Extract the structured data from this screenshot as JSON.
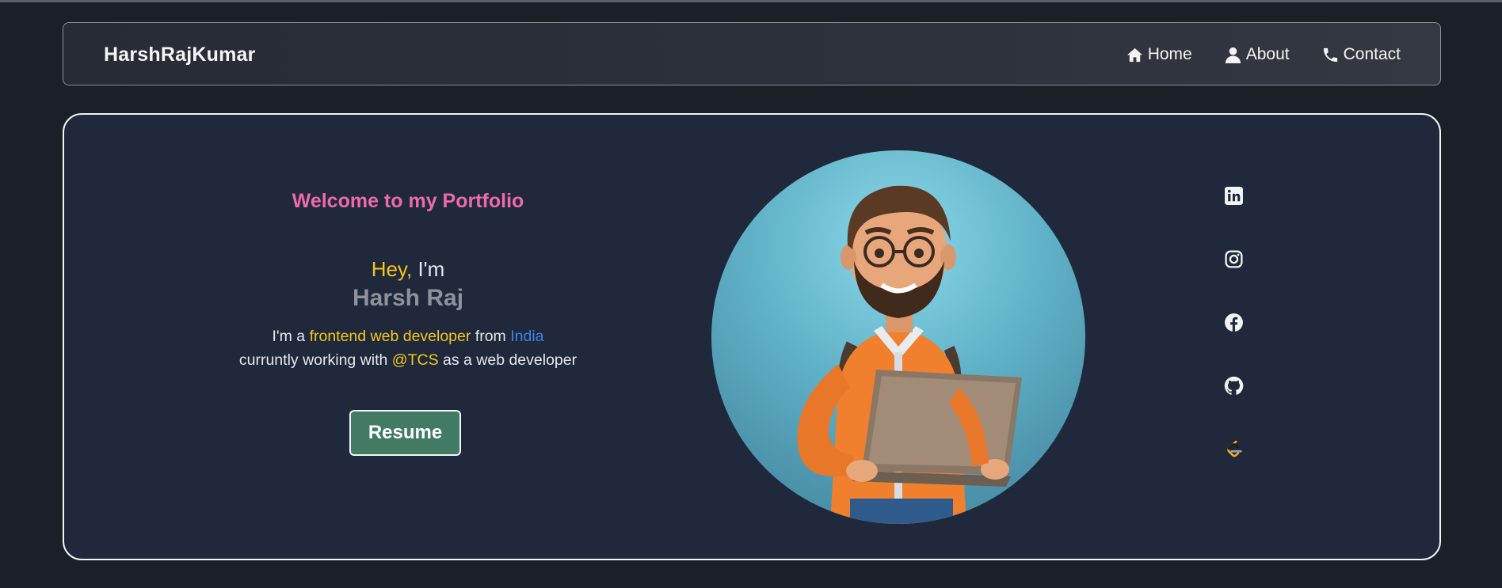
{
  "brand": "HarshRajKumar",
  "nav": [
    {
      "label": "Home",
      "icon": "home-icon"
    },
    {
      "label": "About",
      "icon": "user-icon"
    },
    {
      "label": "Contact",
      "icon": "phone-icon"
    }
  ],
  "hero": {
    "welcome": "Welcome to my Portfolio",
    "hey": "Hey,",
    "im": " I'm",
    "name": "Harsh Raj",
    "bio_line1": {
      "prefix": "I'm a ",
      "role": "frontend web developer",
      "from": " from ",
      "country": "India"
    },
    "bio_line2": {
      "prefix": "curruntly working with ",
      "company": "@TCS",
      "suffix": " as a web developer"
    },
    "resume_label": "Resume"
  },
  "socials": [
    {
      "icon": "linkedin-icon"
    },
    {
      "icon": "instagram-icon"
    },
    {
      "icon": "facebook-icon"
    },
    {
      "icon": "github-icon"
    },
    {
      "icon": "leetcode-icon"
    }
  ],
  "colors": {
    "background": "#1b1f27",
    "card": "#1f293b",
    "accent_pink": "#ef6aa8",
    "accent_yellow": "#f5c518",
    "accent_blue": "#3f82e6",
    "button": "#437a64"
  }
}
